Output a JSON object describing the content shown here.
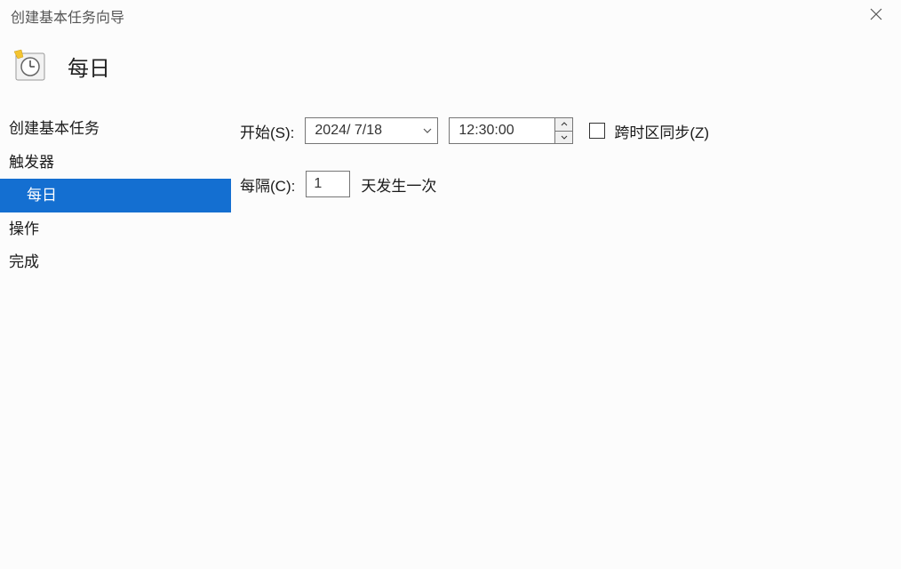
{
  "window": {
    "title": "创建基本任务向导"
  },
  "header": {
    "page_title": "每日"
  },
  "sidebar": {
    "items": [
      {
        "label": "创建基本任务",
        "selected": false,
        "sub": false
      },
      {
        "label": "触发器",
        "selected": false,
        "sub": false
      },
      {
        "label": "每日",
        "selected": true,
        "sub": true
      },
      {
        "label": "操作",
        "selected": false,
        "sub": false
      },
      {
        "label": "完成",
        "selected": false,
        "sub": false
      }
    ]
  },
  "form": {
    "start_label": "开始(S):",
    "date_value": "2024/  7/18",
    "time_value": "12:30:00",
    "sync_label": "跨时区同步(Z)",
    "sync_checked": false,
    "interval_label": "每隔(C):",
    "interval_value": "1",
    "interval_suffix": "天发生一次"
  }
}
